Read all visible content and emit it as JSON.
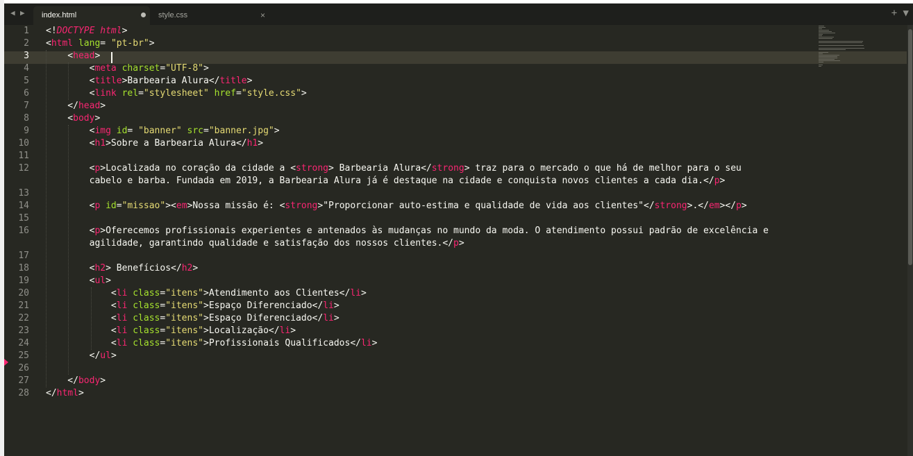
{
  "tabs": [
    {
      "label": "index.html",
      "state": "modified"
    },
    {
      "label": "style.css",
      "state": "close"
    }
  ],
  "nav": {
    "back": "◀",
    "forward": "▶"
  },
  "tab_actions": "+ ▼",
  "active_line": 3,
  "colors": {
    "background": "#272822",
    "tag": "#f92672",
    "attribute": "#a6e22e",
    "string": "#e6db74",
    "text": "#f8f8f2"
  },
  "code_lines": [
    {
      "n": 1,
      "tokens": [
        [
          "p",
          "<!"
        ],
        [
          "i",
          "DOCTYPE"
        ],
        [
          "p",
          " "
        ],
        [
          "i",
          "html"
        ],
        [
          "p",
          ">"
        ]
      ]
    },
    {
      "n": 2,
      "tokens": [
        [
          "p",
          "<"
        ],
        [
          "t",
          "html"
        ],
        [
          "p",
          " "
        ],
        [
          "a",
          "lang"
        ],
        [
          "p",
          "= "
        ],
        [
          "s",
          "\"pt-br\""
        ],
        [
          "p",
          ">"
        ]
      ]
    },
    {
      "n": 3,
      "tokens": [
        [
          "p",
          "    <"
        ],
        [
          "t",
          "head"
        ],
        [
          "p",
          ">"
        ]
      ]
    },
    {
      "n": 4,
      "tokens": [
        [
          "p",
          "        <"
        ],
        [
          "t",
          "meta"
        ],
        [
          "p",
          " "
        ],
        [
          "a",
          "charset"
        ],
        [
          "p",
          "="
        ],
        [
          "s",
          "\"UTF-8\""
        ],
        [
          "p",
          ">"
        ]
      ]
    },
    {
      "n": 5,
      "tokens": [
        [
          "p",
          "        <"
        ],
        [
          "t",
          "title"
        ],
        [
          "p",
          ">Barbearia Alura</"
        ],
        [
          "t",
          "title"
        ],
        [
          "p",
          ">"
        ]
      ]
    },
    {
      "n": 6,
      "tokens": [
        [
          "p",
          "        <"
        ],
        [
          "t",
          "link"
        ],
        [
          "p",
          " "
        ],
        [
          "a",
          "rel"
        ],
        [
          "p",
          "="
        ],
        [
          "s",
          "\"stylesheet\""
        ],
        [
          "p",
          " "
        ],
        [
          "a",
          "href"
        ],
        [
          "p",
          "="
        ],
        [
          "s",
          "\"style.css\""
        ],
        [
          "p",
          ">"
        ]
      ]
    },
    {
      "n": 7,
      "tokens": [
        [
          "p",
          "    </"
        ],
        [
          "t",
          "head"
        ],
        [
          "p",
          ">"
        ]
      ]
    },
    {
      "n": 8,
      "tokens": [
        [
          "p",
          "    <"
        ],
        [
          "t",
          "body"
        ],
        [
          "p",
          ">"
        ]
      ]
    },
    {
      "n": 9,
      "tokens": [
        [
          "p",
          "        <"
        ],
        [
          "t",
          "img"
        ],
        [
          "p",
          " "
        ],
        [
          "a",
          "id"
        ],
        [
          "p",
          "= "
        ],
        [
          "s",
          "\"banner\""
        ],
        [
          "p",
          " "
        ],
        [
          "a",
          "src"
        ],
        [
          "p",
          "="
        ],
        [
          "s",
          "\"banner.jpg\""
        ],
        [
          "p",
          ">"
        ]
      ]
    },
    {
      "n": 10,
      "tokens": [
        [
          "p",
          "        <"
        ],
        [
          "t",
          "h1"
        ],
        [
          "p",
          ">Sobre a Barbearia Alura</"
        ],
        [
          "t",
          "h1"
        ],
        [
          "p",
          ">"
        ]
      ]
    },
    {
      "n": 11,
      "tokens": []
    },
    {
      "n": 12,
      "tokens": [
        [
          "p",
          "        <"
        ],
        [
          "t",
          "p"
        ],
        [
          "p",
          ">Localizada no coração da cidade a <"
        ],
        [
          "t",
          "strong"
        ],
        [
          "p",
          "> Barbearia Alura</"
        ],
        [
          "t",
          "strong"
        ],
        [
          "p",
          "> traz para o mercado o que há de melhor para o seu"
        ]
      ]
    },
    {
      "n": null,
      "tokens": [
        [
          "p",
          "        cabelo e barba. Fundada em 2019, a Barbearia Alura já é destaque na cidade e conquista novos clientes a cada dia.</"
        ],
        [
          "t",
          "p"
        ],
        [
          "p",
          ">"
        ]
      ]
    },
    {
      "n": 13,
      "tokens": []
    },
    {
      "n": 14,
      "tokens": [
        [
          "p",
          "        <"
        ],
        [
          "t",
          "p"
        ],
        [
          "p",
          " "
        ],
        [
          "a",
          "id"
        ],
        [
          "p",
          "="
        ],
        [
          "s",
          "\"missao\""
        ],
        [
          "p",
          ">"
        ],
        [
          "p",
          "<"
        ],
        [
          "t",
          "em"
        ],
        [
          "p",
          ">Nossa missão é: <"
        ],
        [
          "t",
          "strong"
        ],
        [
          "p",
          ">\"Proporcionar auto-estima e qualidade de vida aos clientes\"</"
        ],
        [
          "t",
          "strong"
        ],
        [
          "p",
          ">.</"
        ],
        [
          "t",
          "em"
        ],
        [
          "p",
          "></"
        ],
        [
          "t",
          "p"
        ],
        [
          "p",
          ">"
        ]
      ]
    },
    {
      "n": 15,
      "tokens": []
    },
    {
      "n": 16,
      "tokens": [
        [
          "p",
          "        <"
        ],
        [
          "t",
          "p"
        ],
        [
          "p",
          ">Oferecemos profissionais experientes e antenados às mudanças no mundo da moda. O atendimento possui padrão de excelência e"
        ]
      ]
    },
    {
      "n": null,
      "tokens": [
        [
          "p",
          "        agilidade, garantindo qualidade e satisfação dos nossos clientes.</"
        ],
        [
          "t",
          "p"
        ],
        [
          "p",
          ">"
        ]
      ]
    },
    {
      "n": 17,
      "tokens": []
    },
    {
      "n": 18,
      "tokens": [
        [
          "p",
          "        <"
        ],
        [
          "t",
          "h2"
        ],
        [
          "p",
          "> Benefícios</"
        ],
        [
          "t",
          "h2"
        ],
        [
          "p",
          ">"
        ]
      ]
    },
    {
      "n": 19,
      "tokens": [
        [
          "p",
          "        <"
        ],
        [
          "t",
          "ul"
        ],
        [
          "p",
          ">"
        ]
      ]
    },
    {
      "n": 20,
      "tokens": [
        [
          "p",
          "            <"
        ],
        [
          "t",
          "li"
        ],
        [
          "p",
          " "
        ],
        [
          "a",
          "class"
        ],
        [
          "p",
          "="
        ],
        [
          "s",
          "\"itens\""
        ],
        [
          "p",
          ">Atendimento aos Clientes</"
        ],
        [
          "t",
          "li"
        ],
        [
          "p",
          ">"
        ]
      ]
    },
    {
      "n": 21,
      "tokens": [
        [
          "p",
          "            <"
        ],
        [
          "t",
          "li"
        ],
        [
          "p",
          " "
        ],
        [
          "a",
          "class"
        ],
        [
          "p",
          "="
        ],
        [
          "s",
          "\"itens\""
        ],
        [
          "p",
          ">Espaço Diferenciado</"
        ],
        [
          "t",
          "li"
        ],
        [
          "p",
          ">"
        ]
      ]
    },
    {
      "n": 22,
      "tokens": [
        [
          "p",
          "            <"
        ],
        [
          "t",
          "li"
        ],
        [
          "p",
          " "
        ],
        [
          "a",
          "class"
        ],
        [
          "p",
          "="
        ],
        [
          "s",
          "\"itens\""
        ],
        [
          "p",
          ">Espaço Diferenciado</"
        ],
        [
          "t",
          "li"
        ],
        [
          "p",
          ">"
        ]
      ]
    },
    {
      "n": 23,
      "tokens": [
        [
          "p",
          "            <"
        ],
        [
          "t",
          "li"
        ],
        [
          "p",
          " "
        ],
        [
          "a",
          "class"
        ],
        [
          "p",
          "="
        ],
        [
          "s",
          "\"itens\""
        ],
        [
          "p",
          ">Localização</"
        ],
        [
          "t",
          "li"
        ],
        [
          "p",
          ">"
        ]
      ]
    },
    {
      "n": 24,
      "tokens": [
        [
          "p",
          "            <"
        ],
        [
          "t",
          "li"
        ],
        [
          "p",
          " "
        ],
        [
          "a",
          "class"
        ],
        [
          "p",
          "="
        ],
        [
          "s",
          "\"itens\""
        ],
        [
          "p",
          ">Profissionais Qualificados</"
        ],
        [
          "t",
          "li"
        ],
        [
          "p",
          ">"
        ]
      ]
    },
    {
      "n": 25,
      "tokens": [
        [
          "p",
          "        </"
        ],
        [
          "t",
          "ul"
        ],
        [
          "p",
          ">"
        ]
      ]
    },
    {
      "n": 26,
      "tokens": []
    },
    {
      "n": 27,
      "tokens": [
        [
          "p",
          "    </"
        ],
        [
          "t",
          "body"
        ],
        [
          "p",
          ">"
        ]
      ]
    },
    {
      "n": 28,
      "tokens": [
        [
          "p",
          "</"
        ],
        [
          "t",
          "html"
        ],
        [
          "p",
          ">"
        ]
      ]
    }
  ]
}
